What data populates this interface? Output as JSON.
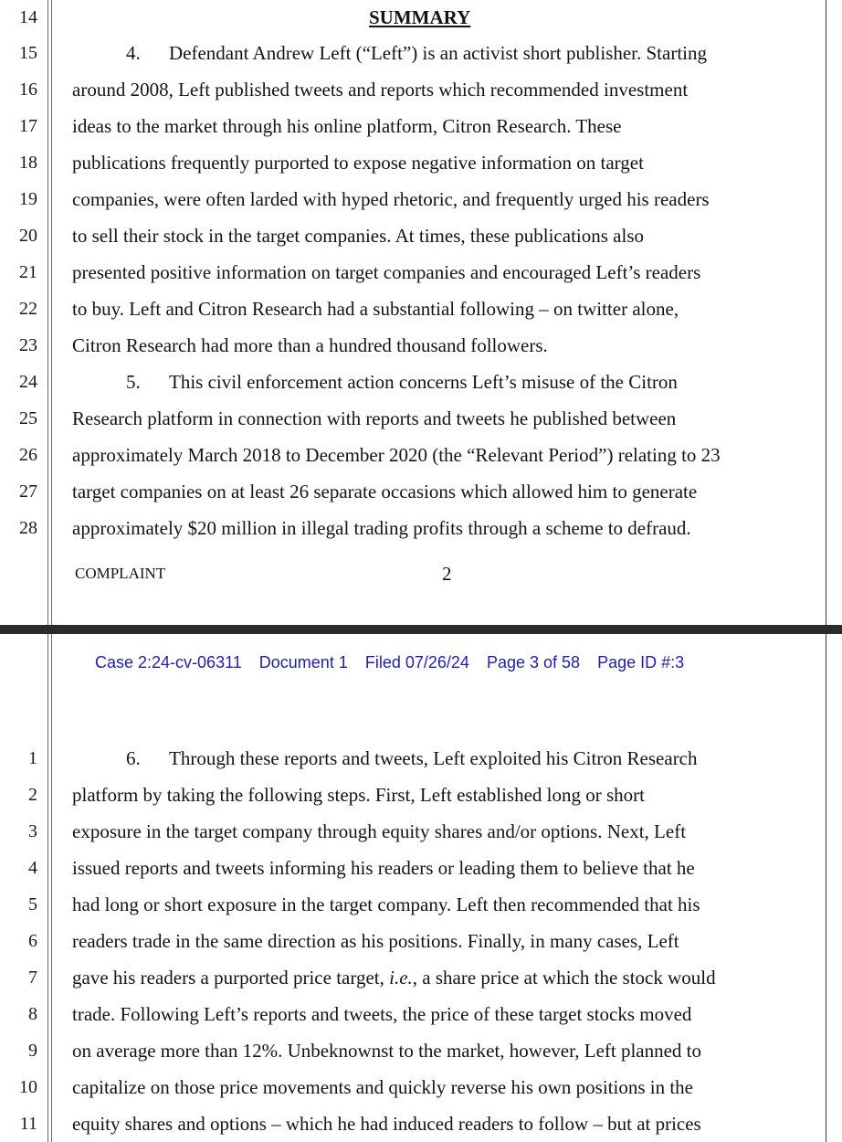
{
  "top_page": {
    "heading": "SUMMARY",
    "heading_line_number": "14",
    "lines": [
      {
        "n": "15",
        "para": "4.",
        "text": "Defendant Andrew Left (“Left”) is an activist short publisher.  Starting"
      },
      {
        "n": "16",
        "text": "around 2008, Left published tweets and reports which recommended investment"
      },
      {
        "n": "17",
        "text": "ideas to the market through his online platform, Citron Research.  These"
      },
      {
        "n": "18",
        "text": "publications frequently purported to expose negative information on target"
      },
      {
        "n": "19",
        "text": "companies, were often larded with hyped rhetoric, and frequently urged his readers"
      },
      {
        "n": "20",
        "text": "to sell their stock in the target companies.  At times, these publications also"
      },
      {
        "n": "21",
        "text": "presented positive information on target companies and encouraged Left’s readers"
      },
      {
        "n": "22",
        "text": "to buy.  Left and Citron Research had a substantial following – on twitter alone,"
      },
      {
        "n": "23",
        "text": "Citron Research had more than a hundred thousand followers."
      },
      {
        "n": "24",
        "para": "5.",
        "text": "This civil enforcement action concerns Left’s misuse of the Citron"
      },
      {
        "n": "25",
        "text": "Research platform in connection with reports and tweets he published between"
      },
      {
        "n": "26",
        "text": "approximately March 2018 to December 2020 (the “Relevant Period”) relating to 23"
      },
      {
        "n": "27",
        "text": "target companies on at least 26 separate occasions which allowed him to generate"
      },
      {
        "n": "28",
        "text": "approximately $20 million in illegal trading profits through a scheme to defraud."
      }
    ],
    "footer_label": "COMPLAINT",
    "footer_page": "2"
  },
  "bottom_page": {
    "case_header": {
      "case": "Case 2:24-cv-06311",
      "document": "Document 1",
      "filed": "Filed 07/26/24",
      "page": "Page 3 of 58",
      "page_id": "Page ID #:3"
    },
    "lines": [
      {
        "n": "1",
        "para": "6.",
        "text": "Through these reports and tweets, Left exploited his Citron Research"
      },
      {
        "n": "2",
        "text": "platform by taking the following steps.  First, Left established long or short"
      },
      {
        "n": "3",
        "text": "exposure in the target company through equity shares and/or options.  Next, Left"
      },
      {
        "n": "4",
        "text": "issued reports and tweets informing his readers or leading them to believe that he"
      },
      {
        "n": "5",
        "text": "had long or short exposure in the target company.  Left then recommended that his"
      },
      {
        "n": "6",
        "text": "readers trade in the same direction as his positions.  Finally, in many cases, Left"
      },
      {
        "n": "7",
        "text_before": "gave his readers a purported price target, ",
        "text_italic": "i.e.",
        "text_after": ", a share price at which the stock would"
      },
      {
        "n": "8",
        "text": "trade.  Following Left’s reports and tweets, the price of these target stocks moved"
      },
      {
        "n": "9",
        "text": "on average more than 12%.  Unbeknownst to the market, however, Left planned to"
      },
      {
        "n": "10",
        "text": "capitalize on those price movements and quickly reverse his own positions in the"
      },
      {
        "n": "11",
        "text": "equity shares and options – which he had induced readers to follow – but at prices"
      }
    ]
  },
  "colors": {
    "case_header": "#1f1fa8",
    "separator": "#2b2b2b",
    "text": "#141414"
  }
}
